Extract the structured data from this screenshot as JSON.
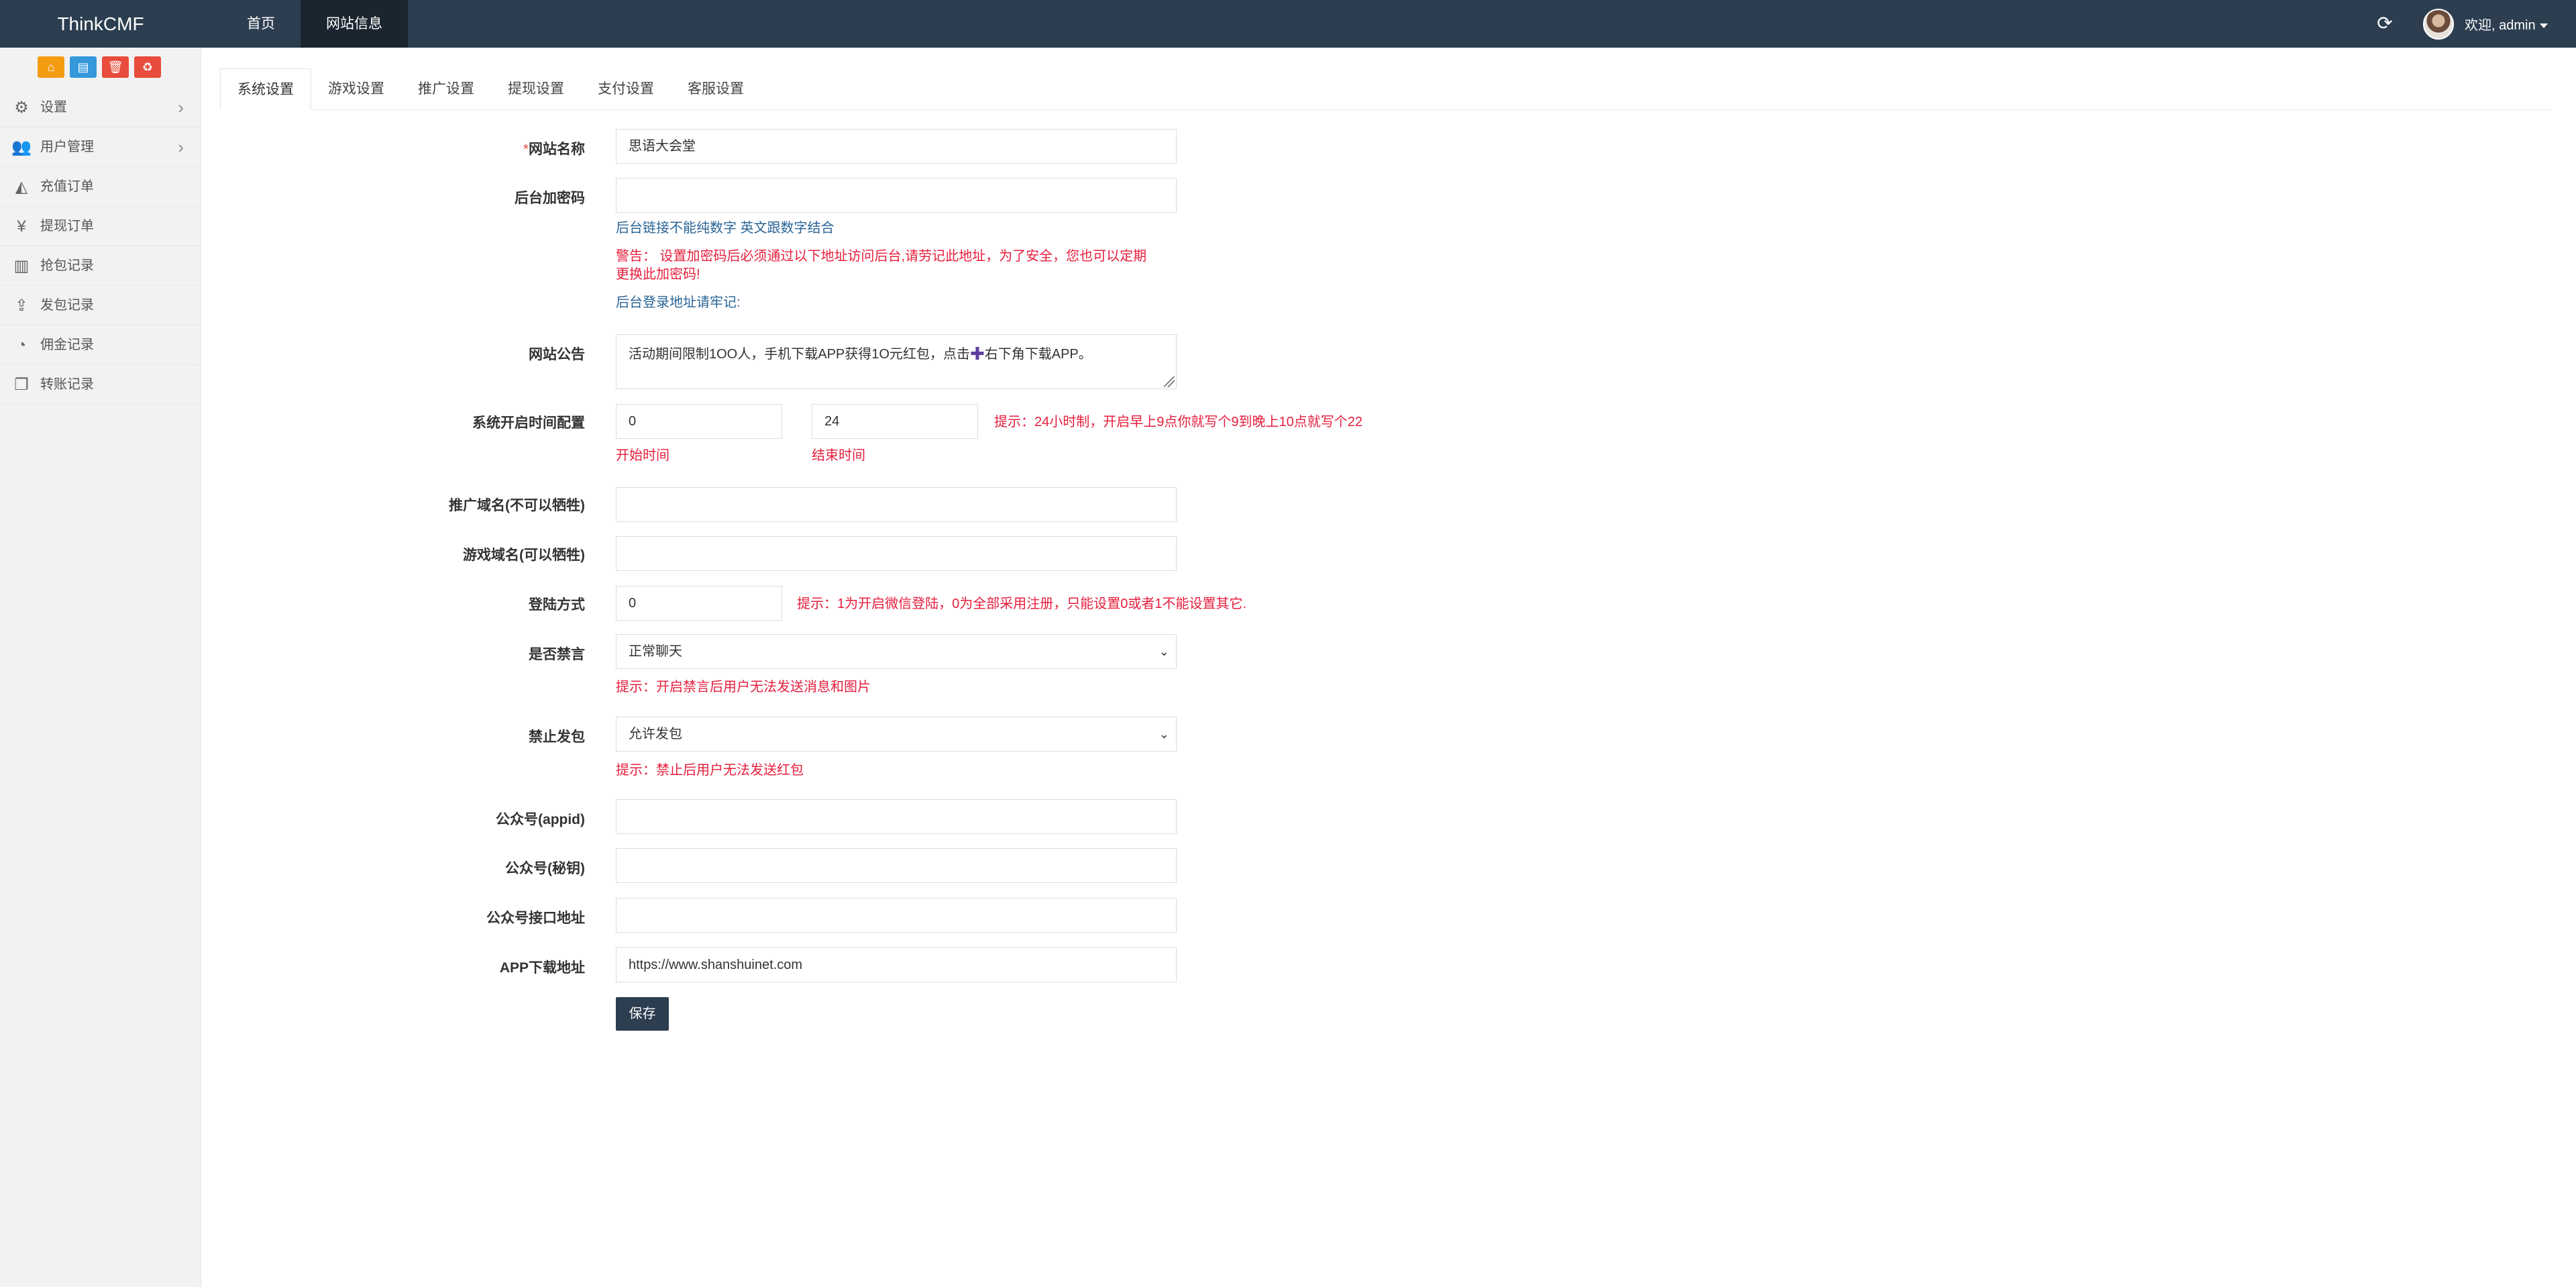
{
  "app": {
    "brand": "ThinkCMF",
    "nav": [
      "首页",
      "网站信息"
    ],
    "user_welcome": "欢迎, admin"
  },
  "sidebar": {
    "items": [
      {
        "label": "设置",
        "icon": "gear-icon",
        "has_children": true
      },
      {
        "label": "用户管理",
        "icon": "users-icon",
        "has_children": true
      },
      {
        "label": "充值订单",
        "icon": "area-chart-icon",
        "has_children": false
      },
      {
        "label": "提现订单",
        "icon": "yen-icon",
        "has_children": false
      },
      {
        "label": "抢包记录",
        "icon": "bar-chart-icon",
        "has_children": false
      },
      {
        "label": "发包记录",
        "icon": "upload-icon",
        "has_children": false
      },
      {
        "label": "佣金记录",
        "icon": "pie-chart-icon",
        "has_children": false
      },
      {
        "label": "转账记录",
        "icon": "clone-icon",
        "has_children": false
      }
    ]
  },
  "tabs": [
    "系统设置",
    "游戏设置",
    "推广设置",
    "提现设置",
    "支付设置",
    "客服设置"
  ],
  "form": {
    "site_name": {
      "label": "网站名称",
      "value": "思语大会堂"
    },
    "admin_password": {
      "label": "后台加密码",
      "value": "",
      "help1": "后台链接不能纯数字 英文跟数字结合",
      "warn_line1": "警告： 设置加密码后必须通过以下地址访问后台,请劳记此地址，为了安全，您也可以定期",
      "warn_line2": "更换此加密码!",
      "help2": "后台登录地址请牢记:"
    },
    "notice": {
      "label": "网站公告",
      "value_before": "活动期间限制1OO人，手机下载APP获得1O元红包，点击",
      "value_after": "右下角下载APP。"
    },
    "open_time": {
      "label": "系统开启时间配置",
      "start": "0",
      "end": "24",
      "start_label": "开始时间",
      "end_label": "结束时间",
      "hint": "提示：24小时制，开启早上9点你就写个9到晚上10点就写个22"
    },
    "promo_domain": {
      "label": "推广域名(不可以牺牲)",
      "value": ""
    },
    "game_domain": {
      "label": "游戏域名(可以牺牲)",
      "value": ""
    },
    "login_mode": {
      "label": "登陆方式",
      "value": "0",
      "hint": "提示：1为开启微信登陆，0为全部采用注册，只能设置0或者1不能设置其它."
    },
    "mute": {
      "label": "是否禁言",
      "selected": "正常聊天",
      "hint": "提示：开启禁言后用户无法发送消息和图片"
    },
    "ban_packet": {
      "label": "禁止发包",
      "selected": "允许发包",
      "hint": "提示：禁止后用户无法发送红包"
    },
    "mp_appid": {
      "label": "公众号(appid)",
      "value": ""
    },
    "mp_secret": {
      "label": "公众号(秘钥)",
      "value": ""
    },
    "mp_api": {
      "label": "公众号接口地址",
      "value": ""
    },
    "app_url": {
      "label": "APP下载地址",
      "value": "https://www.shanshuinet.com"
    },
    "save_label": "保存"
  }
}
